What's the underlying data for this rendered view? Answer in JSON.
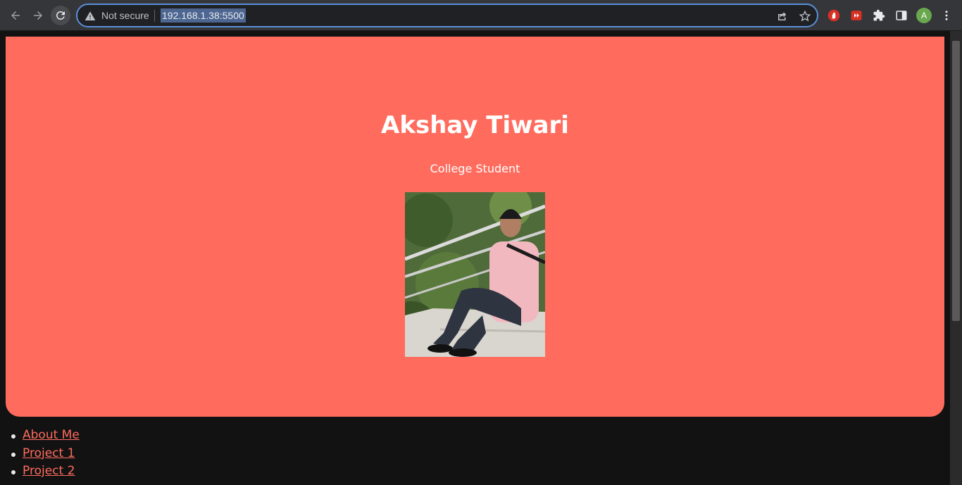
{
  "browser": {
    "security_label": "Not secure",
    "url": "192.168.1.38:5500",
    "profile_initial": "A",
    "icons": {
      "back": "back-arrow-icon",
      "forward": "forward-arrow-icon",
      "reload": "reload-icon",
      "warning": "warning-triangle-icon",
      "share": "share-icon",
      "bookmark": "star-icon",
      "extensions": [
        "hand-stop-extension-icon",
        "video-extension-icon",
        "puzzle-extension-icon",
        "side-panel-icon"
      ],
      "menu": "kebab-menu-icon"
    }
  },
  "page": {
    "name": "Akshay Tiwari",
    "subtitle": "College Student",
    "nav_links": [
      "About Me",
      "Project 1",
      "Project 2"
    ]
  },
  "colors": {
    "accent": "#ff6c5e",
    "page_background": "#121212",
    "toolbar": "#35363a",
    "url_highlight": "#4c6691"
  }
}
